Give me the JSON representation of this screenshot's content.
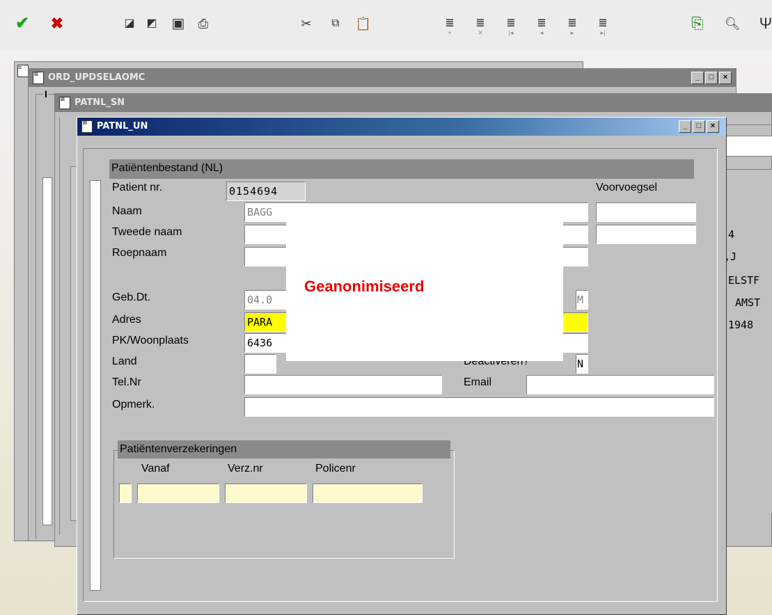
{
  "toolbar": {
    "icons": [
      "check-icon",
      "cancel-icon",
      "dock-icon",
      "undock-icon",
      "save-icon",
      "print-icon",
      "cut-icon",
      "copy-icon",
      "paste-icon",
      "record-insert-icon",
      "record-delete-icon",
      "record-first-icon",
      "record-prev-icon",
      "record-next-icon",
      "record-last-icon",
      "exit-icon",
      "search-icon",
      "tools-icon"
    ]
  },
  "windows": {
    "back": {
      "title": "ORD_UPDSELAOMC",
      "frame_label": "I"
    },
    "middle": {
      "title": "PATNL_SN"
    },
    "front": {
      "title": "PATNL_UN"
    }
  },
  "middle_right": {
    "lines": [
      "4",
      ",J",
      "ELSTF",
      "AMST",
      "1948"
    ]
  },
  "form": {
    "section_title": "Patiëntenbestand (NL)",
    "labels": {
      "patient_nr": "Patient nr.",
      "naam": "Naam",
      "tweede_naam": "Tweede naam",
      "roepnaam": "Roepnaam",
      "geb_dt": "Geb.Dt.",
      "adres": "Adres",
      "pk_woonplaats": "PK/Woonplaats",
      "land": "Land",
      "tel_nr": "Tel.Nr",
      "opmerk": "Opmerk.",
      "voorvoegsel": "Voorvoegsel",
      "deactiveren": "Deactiveren?",
      "email": "Email"
    },
    "values": {
      "patient_nr": "0154694",
      "naam": "BAGG",
      "tweede_naam": "",
      "roepnaam": "",
      "geb_dt": "04.0",
      "geslacht": "M",
      "adres": "PARA",
      "pk_woonplaats": "6436",
      "land": "",
      "deactiveren": "N",
      "tel_nr": "",
      "email": "",
      "opmerk": "",
      "voorvoegsel": ""
    }
  },
  "anonymized": {
    "text": "Geanonimiseerd",
    "color": "#ee0000"
  },
  "insurance": {
    "section_title": "Patiëntenverzekeringen",
    "columns": [
      "Vanaf",
      "Verz.nr",
      "Policenr"
    ],
    "rows": [
      [
        "",
        "",
        ""
      ]
    ]
  },
  "colors": {
    "accent_title": "#0a246a",
    "highlight": "#ffff00",
    "pale": "#fffacd"
  }
}
